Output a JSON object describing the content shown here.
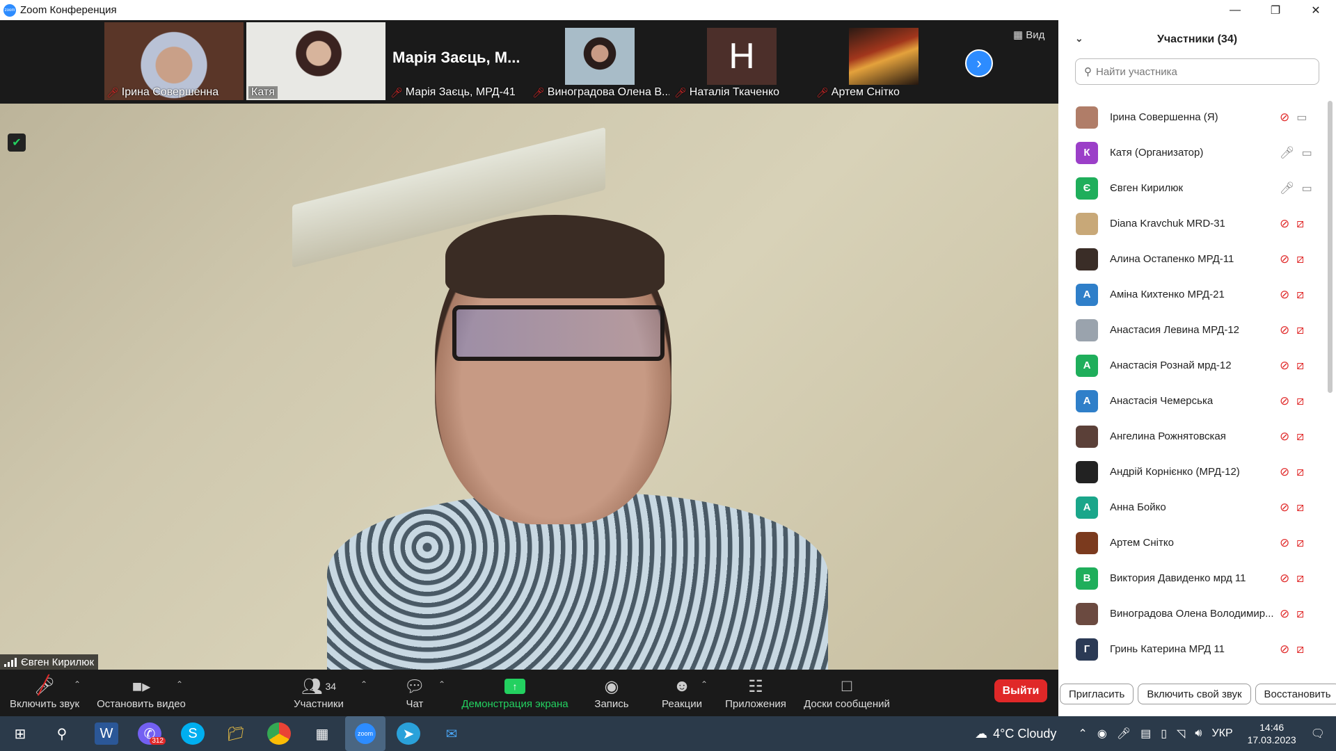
{
  "window": {
    "title": "Zoom Конференция"
  },
  "thumbnails": [
    {
      "name": "Ірина Совершенна",
      "muted": true
    },
    {
      "name": "Катя",
      "muted": false
    },
    {
      "name": "Марія Заєць, МРД-41",
      "muted": true,
      "big_name": "Марія Заєць, М..."
    },
    {
      "name": "Виноградова Олена В...",
      "muted": true
    },
    {
      "name": "Наталія Ткаченко",
      "muted": true,
      "letter": "Н"
    },
    {
      "name": "Артем Снітко",
      "muted": true
    }
  ],
  "view_label": "Вид",
  "active_speaker": "Євген Кирилюк",
  "toolbar": {
    "audio_label": "Включить звук",
    "video_label": "Остановить видео",
    "participants_label": "Участники",
    "participants_count": "34",
    "chat_label": "Чат",
    "share_label": "Демонстрация экрана",
    "record_label": "Запись",
    "reactions_label": "Реакции",
    "apps_label": "Приложения",
    "whiteboards_label": "Доски сообщений",
    "leave_label": "Выйти"
  },
  "panel": {
    "title": "Участники (34)",
    "search_placeholder": "Найти участника",
    "participants": [
      {
        "name": "Ірина Совершенна (Я)",
        "avatar": "",
        "color": "#b07d68",
        "mic": "off",
        "cam": "on"
      },
      {
        "name": "Катя (Организатор)",
        "avatar": "К",
        "color": "#9b3fc8",
        "mic": "on",
        "cam": "on"
      },
      {
        "name": "Євген Кирилюк",
        "avatar": "Є",
        "color": "#1fae5b",
        "mic": "on",
        "cam": "on"
      },
      {
        "name": "Diana Kravchuk MRD-31",
        "avatar": "",
        "color": "#c8a878",
        "mic": "off",
        "cam": "off"
      },
      {
        "name": "Алина Остапенко МРД-11",
        "avatar": "",
        "color": "#3a2d27",
        "mic": "off",
        "cam": "off"
      },
      {
        "name": "Аміна Кихтенко МРД-21",
        "avatar": "А",
        "color": "#2f7fc9",
        "mic": "off",
        "cam": "off"
      },
      {
        "name": "Анастасия Левина МРД-12",
        "avatar": "",
        "color": "#9aa3ad",
        "mic": "off",
        "cam": "off"
      },
      {
        "name": "Анастасія Рознай мрд-12",
        "avatar": "А",
        "color": "#1fae5b",
        "mic": "off",
        "cam": "off"
      },
      {
        "name": "Анастасія Чемерська",
        "avatar": "А",
        "color": "#2f7fc9",
        "mic": "off",
        "cam": "off"
      },
      {
        "name": "Ангелина Рожнятовская",
        "avatar": "",
        "color": "#5b4038",
        "mic": "off",
        "cam": "off"
      },
      {
        "name": "Андрій Корнієнко (МРД-12)",
        "avatar": "",
        "color": "#222222",
        "mic": "off",
        "cam": "off"
      },
      {
        "name": "Анна Бойко",
        "avatar": "A",
        "color": "#1aa68a",
        "mic": "off",
        "cam": "off"
      },
      {
        "name": "Артем Снітко",
        "avatar": "",
        "color": "#7b3a1e",
        "mic": "off",
        "cam": "off"
      },
      {
        "name": "Виктория Давиденко мрд 11",
        "avatar": "В",
        "color": "#1fae5b",
        "mic": "off",
        "cam": "off"
      },
      {
        "name": "Виноградова Олена Володимир...",
        "avatar": "",
        "color": "#6b4a40",
        "mic": "off",
        "cam": "off"
      },
      {
        "name": "Гринь Катерина МРД 11",
        "avatar": "Г",
        "color": "#2b3a55",
        "mic": "off",
        "cam": "off"
      }
    ],
    "buttons": {
      "invite": "Пригласить",
      "unmute": "Включить свой звук",
      "restore": "Восстановить"
    }
  },
  "taskbar": {
    "viber_badge": "312",
    "weather": "4°C  Cloudy",
    "lang": "УКР",
    "time": "14:46",
    "date": "17.03.2023"
  }
}
